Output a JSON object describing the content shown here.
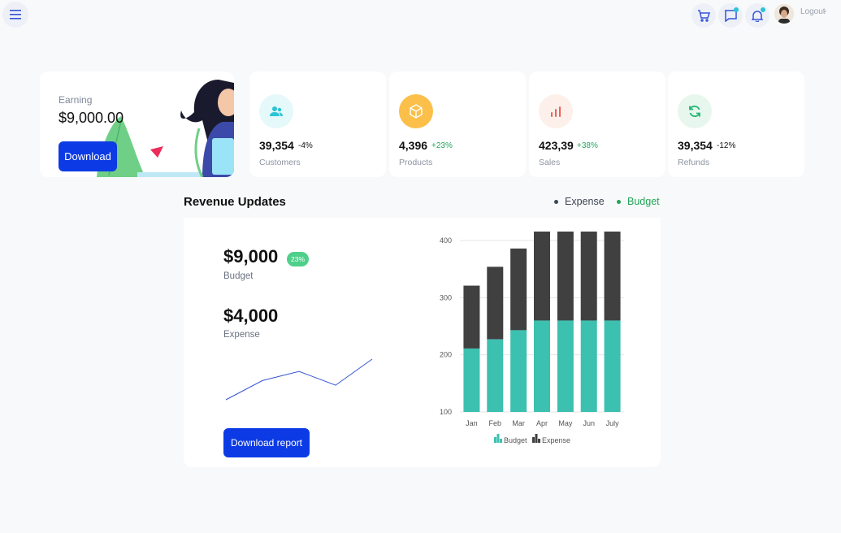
{
  "topbar": {
    "menu_icon": "hamburger-icon",
    "cart_icon": "cart-icon",
    "chat_icon": "chat-icon",
    "bell_icon": "bell-icon",
    "logout_label": "Logout",
    "accent": "#2bc3d6"
  },
  "earning": {
    "label": "Earning",
    "value": "$9,000.00",
    "button": "Download"
  },
  "stats": [
    {
      "value": "39,354",
      "change": "-4%",
      "label": "Customers",
      "icon": "users-icon",
      "color": "#2bc3d6",
      "bg": "#e5f8fa",
      "change_color": "#111111"
    },
    {
      "value": "4,396",
      "change": "+23%",
      "label": "Products",
      "icon": "box-icon",
      "color": "#ffffff",
      "bg": "#fbbf4a",
      "change_color": "#23a55a"
    },
    {
      "value": "423,39",
      "change": "+38%",
      "label": "Sales",
      "icon": "bar-chart-icon",
      "color": "#f0605a",
      "bg": "#fdf0ea",
      "change_color": "#23a55a"
    },
    {
      "value": "39,354",
      "change": "-12%",
      "label": "Refunds",
      "icon": "refresh-icon",
      "color": "#21b573",
      "bg": "#e8f7ee",
      "change_color": "#111111"
    }
  ],
  "revenue": {
    "title": "Revenue Updates",
    "legend_expense": "Expense",
    "legend_budget": "Budget",
    "budget_value": "$9,000",
    "budget_pct": "23%",
    "budget_label": "Budget",
    "expense_value": "$4,000",
    "expense_label": "Expense",
    "report_button": "Download report"
  },
  "chart_data": {
    "type": "bar",
    "stacked": true,
    "categories": [
      "Jan",
      "Feb",
      "Mar",
      "Apr",
      "May",
      "Jun",
      "July"
    ],
    "series": [
      {
        "name": "Budget",
        "values": [
          111,
          127,
          143,
          160,
          160,
          160,
          160
        ],
        "color": "#3cc0b0"
      },
      {
        "name": "Expense",
        "values": [
          110,
          127,
          143,
          160,
          160,
          160,
          160
        ],
        "color": "#404040"
      }
    ],
    "ylim": [
      100,
      400
    ],
    "yticks": [
      "100",
      "200",
      "300",
      "400"
    ],
    "legend": "bottom",
    "grid": true
  },
  "sparkline": {
    "values": [
      5,
      30,
      42,
      24,
      58
    ],
    "color": "#3554d6"
  }
}
